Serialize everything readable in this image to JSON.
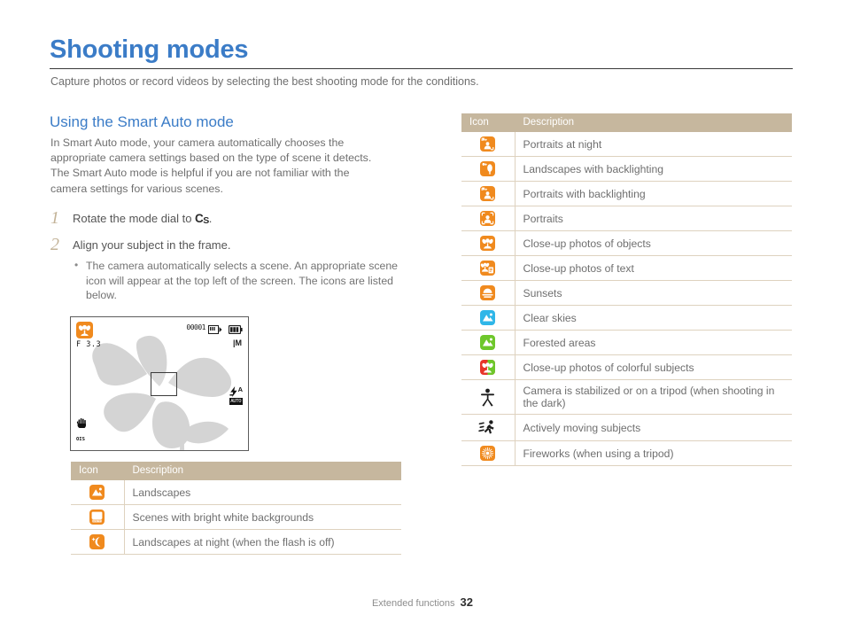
{
  "document": {
    "title": "Shooting modes",
    "subtitle": "Capture photos or record videos by selecting the best shooting mode for the conditions.",
    "section_heading": "Using the Smart Auto mode",
    "intro": "In Smart Auto mode, your camera automatically chooses the appropriate camera settings based on the type of scene it detects. The Smart Auto mode is helpful if you are not familiar with the camera settings for various scenes.",
    "accent_blue": "#3b7cc7",
    "accent_tan": "#c6b79e",
    "icon_orange": "#f08a1e"
  },
  "steps": [
    {
      "number": "1",
      "text_before": "Rotate the mode dial to ",
      "glyph": "C",
      "glyph_sub": "S",
      "text_after": ".",
      "bullets": []
    },
    {
      "number": "2",
      "text_before": "Align your subject in the frame.",
      "glyph": "",
      "glyph_sub": "",
      "text_after": "",
      "bullets": [
        "The camera automatically selects a scene. An appropriate scene icon will appear at the top left of the screen. The icons are listed below."
      ]
    }
  ],
  "lcd": {
    "aperture": "F 3.3",
    "shots_remaining": "00001",
    "memory_card_icon": "memory-card-icon",
    "battery_icon": "battery-full-icon",
    "metering_mark": "M",
    "macro_icon": "macro-flower-icon",
    "flash_mode": "A",
    "flash_tag": "AUTO",
    "stabilizer_label": "OIS",
    "stabilizer_icon": "hand-shake-icon",
    "focus_frame": "focus-frame"
  },
  "table_left": {
    "headers": [
      "Icon",
      "Description"
    ],
    "rows": [
      {
        "icon_name": "landscape-icon",
        "bg": "#f08a1e",
        "glyph": "landscape",
        "description": "Landscapes"
      },
      {
        "icon_name": "white-background-icon",
        "bg": "#f08a1e",
        "glyph": "white-bg",
        "description": "Scenes with bright white backgrounds"
      },
      {
        "icon_name": "night-landscape-icon",
        "bg": "#f08a1e",
        "glyph": "moon",
        "description": "Landscapes at night (when the flash is off)"
      }
    ]
  },
  "table_right": {
    "headers": [
      "Icon",
      "Description"
    ],
    "rows": [
      {
        "icon_name": "night-portrait-icon",
        "bg": "#f08a1e",
        "glyph": "portrait-night",
        "description": "Portraits at night"
      },
      {
        "icon_name": "backlight-landscape-icon",
        "bg": "#f08a1e",
        "glyph": "tree-backlight",
        "description": "Landscapes with backlighting"
      },
      {
        "icon_name": "backlight-portrait-icon",
        "bg": "#f08a1e",
        "glyph": "portrait-backlight",
        "description": "Portraits with backlighting"
      },
      {
        "icon_name": "portrait-icon",
        "bg": "#f08a1e",
        "glyph": "portrait",
        "description": "Portraits"
      },
      {
        "icon_name": "macro-icon",
        "bg": "#f08a1e",
        "glyph": "flower",
        "description": "Close-up photos of objects"
      },
      {
        "icon_name": "macro-text-icon",
        "bg": "#f08a1e",
        "glyph": "flower-text",
        "description": "Close-up photos of text"
      },
      {
        "icon_name": "sunset-icon",
        "bg": "#f08a1e",
        "glyph": "sunset",
        "description": "Sunsets"
      },
      {
        "icon_name": "clear-sky-icon",
        "bg": "#2fb6e8",
        "glyph": "landscape",
        "description": "Clear skies"
      },
      {
        "icon_name": "forest-icon",
        "bg": "#6ec72b",
        "glyph": "landscape",
        "description": "Forested areas"
      },
      {
        "icon_name": "colorful-macro-icon",
        "bg": "#e8342a",
        "glyph": "flower-color",
        "description": "Close-up photos of colorful subjects"
      },
      {
        "icon_name": "tripod-icon",
        "bg": "none",
        "glyph": "tripod",
        "description": "Camera is stabilized or on a tripod (when shooting in the dark)"
      },
      {
        "icon_name": "action-icon",
        "bg": "none",
        "glyph": "runner",
        "description": "Actively moving subjects"
      },
      {
        "icon_name": "fireworks-icon",
        "bg": "#f08a1e",
        "glyph": "fireworks",
        "description": "Fireworks (when using a tripod)"
      }
    ]
  },
  "footer": {
    "section": "Extended functions",
    "page": "32"
  }
}
